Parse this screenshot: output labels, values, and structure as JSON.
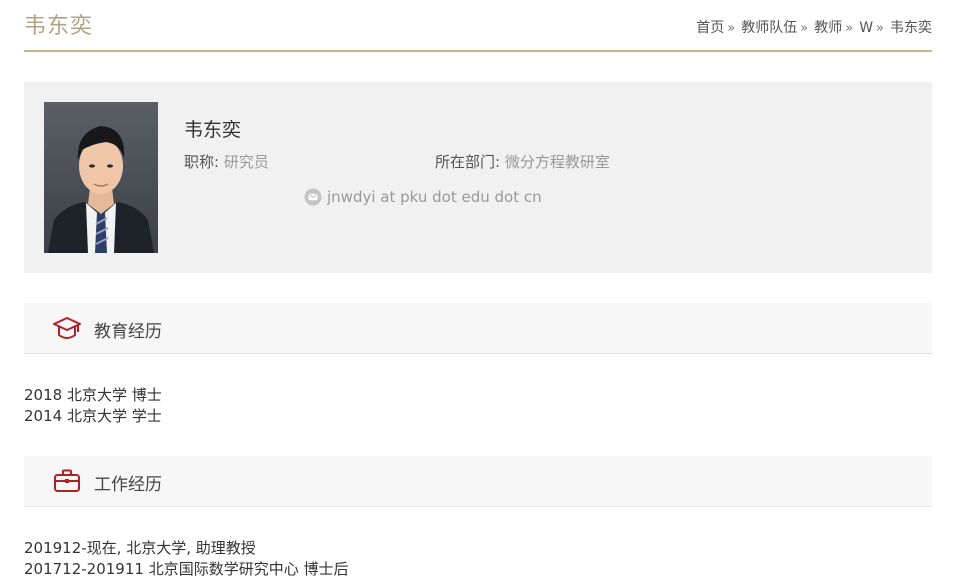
{
  "page": {
    "title": "韦东奕"
  },
  "breadcrumb": [
    {
      "label": "首页"
    },
    {
      "label": "教师队伍"
    },
    {
      "label": "教师"
    },
    {
      "label": "W"
    },
    {
      "label": "韦东奕"
    }
  ],
  "breadcrumb_separator": "»",
  "profile": {
    "name": "韦东奕",
    "title_label": "职称:",
    "title_value": "研究员",
    "dept_label": "所在部门:",
    "dept_value": "微分方程教研室",
    "email": "jnwdyi at pku dot edu dot cn",
    "icons": {
      "email": "mail-icon"
    }
  },
  "education": {
    "heading": "教育经历",
    "icon": "graduation-cap-icon",
    "items": [
      "2018 北京大学 博士",
      "2014 北京大学 学士"
    ]
  },
  "work": {
    "heading": "工作经历",
    "icon": "briefcase-icon",
    "items": [
      "201912-现在, 北京大学, 助理教授",
      "201712-201911 北京国际数学研究中心 博士后"
    ]
  },
  "colors": {
    "accent": "#b4a287",
    "rule": "#c9b28f",
    "icon_red": "#b21f24",
    "card_bg": "#f1f1f1"
  }
}
